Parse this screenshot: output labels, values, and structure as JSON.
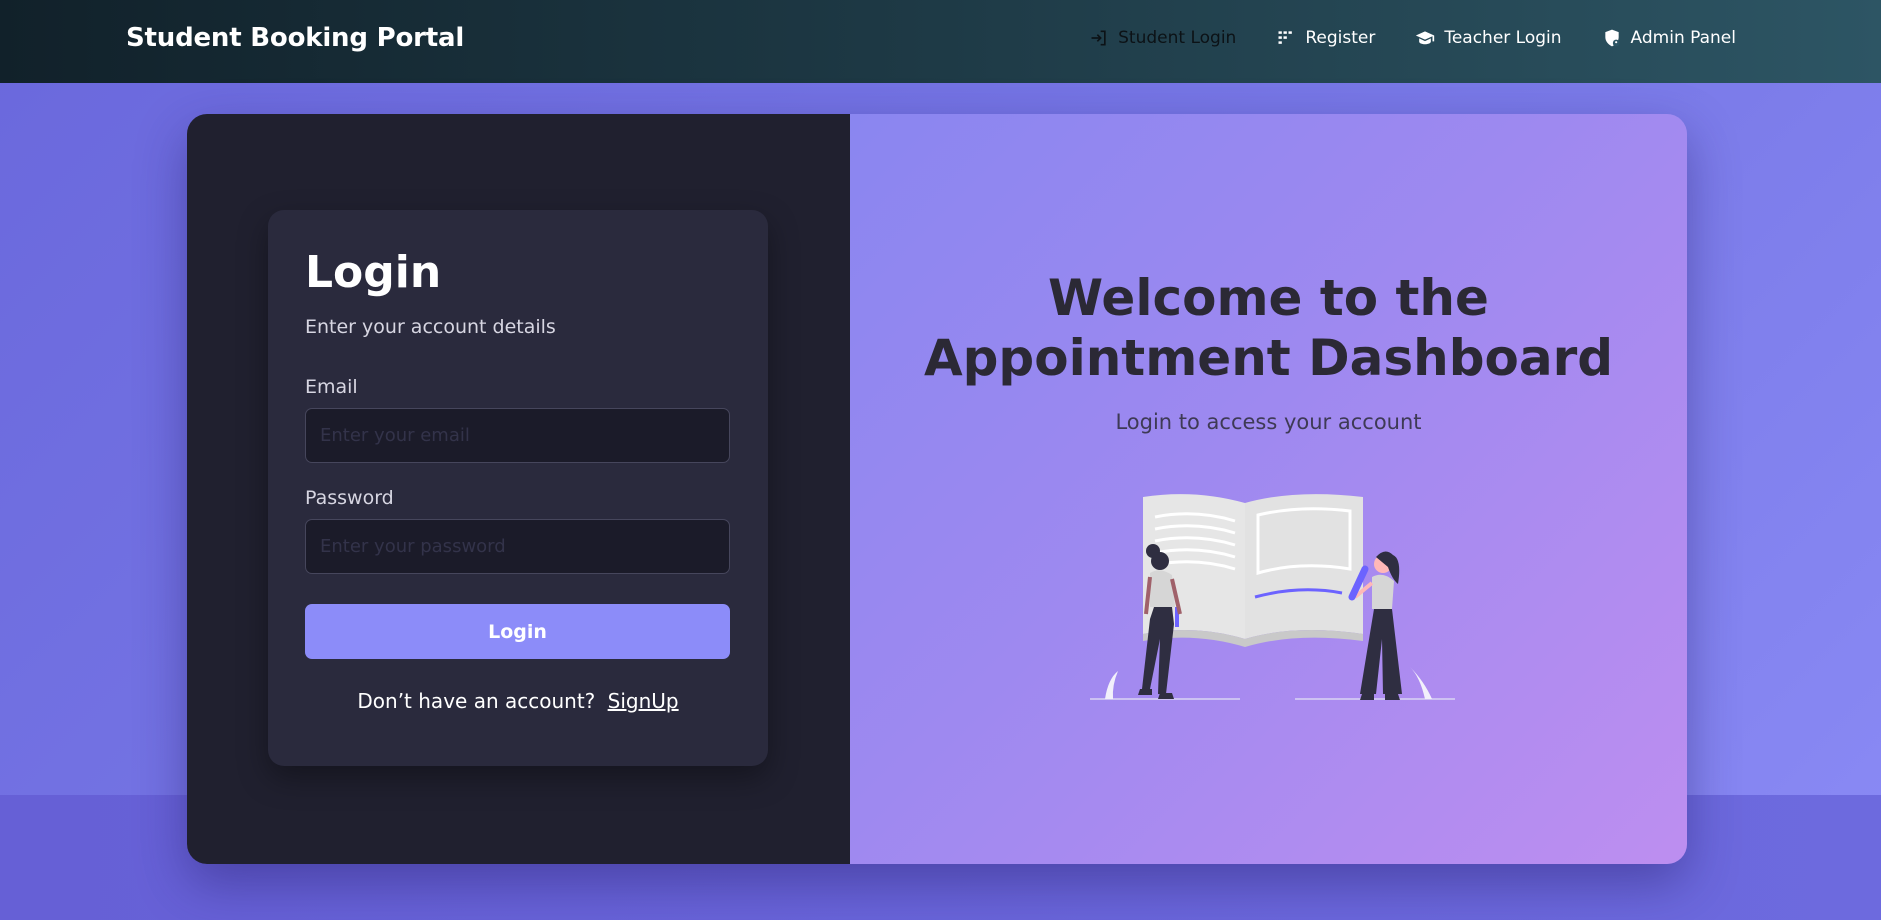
{
  "navbar": {
    "brand": "Student Booking Portal",
    "links": [
      {
        "label": "Student Login",
        "icon": "login-icon"
      },
      {
        "label": "Register",
        "icon": "grid-icon"
      },
      {
        "label": "Teacher Login",
        "icon": "graduation-cap-icon"
      },
      {
        "label": "Admin Panel",
        "icon": "shield-user-icon"
      }
    ]
  },
  "login": {
    "title": "Login",
    "subtitle": "Enter your account details",
    "email_label": "Email",
    "email_placeholder": "Enter your email",
    "email_value": "",
    "password_label": "Password",
    "password_placeholder": "Enter your password",
    "password_value": "",
    "button_label": "Login",
    "signup_prompt": "Don’t have an account?",
    "signup_link": "SignUp"
  },
  "hero": {
    "title_line1": "Welcome to the",
    "title_line2": "Appointment Dashboard",
    "subtitle": "Login to access your account",
    "illustration": "book-reading-illustration"
  },
  "colors": {
    "accent": "#8c8cf9",
    "panel_dark": "#20202f",
    "card_dark": "#2a2a3d"
  }
}
